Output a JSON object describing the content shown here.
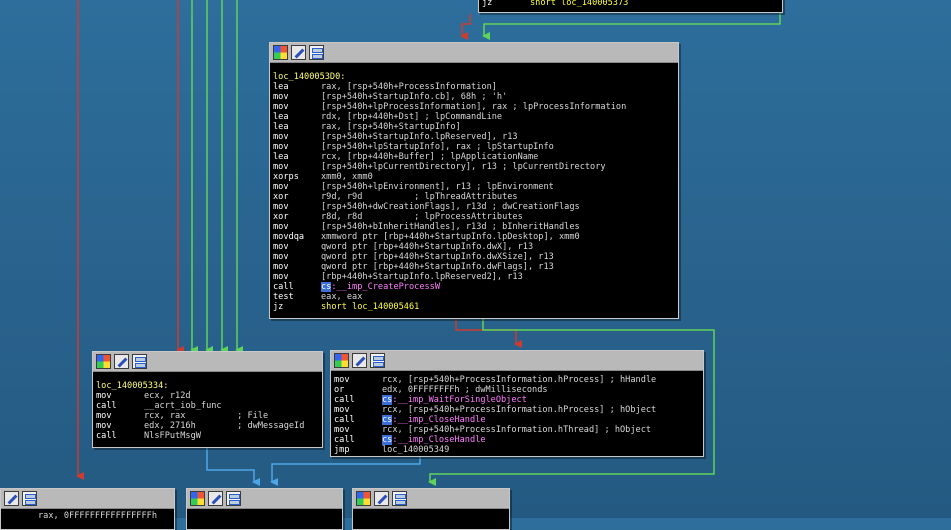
{
  "colors": {
    "background": "#2a6590",
    "edge_red": "#cf3b2f",
    "edge_green": "#5fd35a",
    "edge_blue": "#4ea6e6",
    "node_bg": "#000000",
    "titlebar": "#b9b9b9",
    "highlight": "#3b6fd8",
    "annotation_arrow": "#e3342a"
  },
  "icons": [
    "color-icon",
    "edit-icon",
    "graph-icon"
  ],
  "top_fragment": {
    "mnemonic": "jz",
    "operand": "short loc_140005373"
  },
  "main_block": {
    "label": "loc_1400053D0:",
    "lines": [
      {
        "mn": "lea",
        "op": "rax, [rsp+540h+ProcessInformation]"
      },
      {
        "mn": "mov",
        "op": "[rsp+540h+StartupInfo.cb], 68h ; 'h'"
      },
      {
        "mn": "mov",
        "op": "[rsp+540h+lpProcessInformation], rax ; lpProcessInformation"
      },
      {
        "mn": "lea",
        "op": "rdx, [rbp+440h+Dst] ; lpCommandLine"
      },
      {
        "mn": "lea",
        "op": "rax, [rsp+540h+StartupInfo]"
      },
      {
        "mn": "mov",
        "op": "[rsp+540h+StartupInfo.lpReserved], r13"
      },
      {
        "mn": "mov",
        "op": "[rsp+540h+lpStartupInfo], rax ; lpStartupInfo"
      },
      {
        "mn": "lea",
        "op": "rcx, [rbp+440h+Buffer] ; lpApplicationName"
      },
      {
        "mn": "mov",
        "op": "[rsp+540h+lpCurrentDirectory], r13 ; lpCurrentDirectory"
      },
      {
        "mn": "xorps",
        "op": "xmm0, xmm0"
      },
      {
        "mn": "mov",
        "op": "[rsp+540h+lpEnvironment], r13 ; lpEnvironment"
      },
      {
        "mn": "xor",
        "op": "r9d, r9d          ; lpThreadAttributes"
      },
      {
        "mn": "mov",
        "op": "[rsp+540h+dwCreationFlags], r13d ; dwCreationFlags"
      },
      {
        "mn": "xor",
        "op": "r8d, r8d          ; lpProcessAttributes"
      },
      {
        "mn": "mov",
        "op": "[rsp+540h+bInheritHandles], r13d ; bInheritHandles"
      },
      {
        "mn": "movdqa",
        "op": "xmmword ptr [rbp+440h+StartupInfo.lpDesktop], xmm0"
      },
      {
        "mn": "mov",
        "op": "qword ptr [rbp+440h+StartupInfo.dwX], r13"
      },
      {
        "mn": "mov",
        "op": "qword ptr [rbp+440h+StartupInfo.dwXSize], r13"
      },
      {
        "mn": "mov",
        "op": "qword ptr [rbp+440h+StartupInfo.dwFlags], r13"
      },
      {
        "mn": "mov",
        "op": "[rbp+440h+StartupInfo.lpReserved2], r13"
      }
    ],
    "call": {
      "mn": "call",
      "prefix": "cs",
      "rest": ":__imp_CreateProcessW"
    },
    "test": {
      "mn": "test",
      "op": "eax, eax"
    },
    "jz": {
      "mn": "jz",
      "op": "short loc_140005461"
    }
  },
  "left_block": {
    "label": "loc_140005334:",
    "lines": [
      {
        "mn": "mov",
        "op": "ecx, r12d"
      },
      {
        "mn": "call",
        "op": "__acrt_iob_func"
      },
      {
        "mn": "mov",
        "op": "rcx, rax          ; File"
      },
      {
        "mn": "mov",
        "op": "edx, 2716h        ; dwMessageId"
      },
      {
        "mn": "call",
        "op": "NlsFPutMsgW"
      }
    ]
  },
  "right_block": {
    "lines": [
      {
        "mn": "mov",
        "op": "rcx, [rsp+540h+ProcessInformation.hProcess] ; hHandle"
      },
      {
        "mn": "or",
        "op": "edx, 0FFFFFFFFh ; dwMilliseconds"
      },
      {
        "mn": "call",
        "prefix": "cs",
        "op": ":__imp_WaitForSingleObject"
      },
      {
        "mn": "mov",
        "op": "rcx, [rsp+540h+ProcessInformation.hProcess] ; hObject"
      },
      {
        "mn": "call",
        "prefix": "cs",
        "op": ":__imp_CloseHandle"
      },
      {
        "mn": "mov",
        "op": "rcx, [rsp+540h+ProcessInformation.hThread] ; hObject"
      },
      {
        "mn": "call",
        "prefix": "cs",
        "op": ":__imp_CloseHandle"
      },
      {
        "mn": "jmp",
        "op": "loc_140005349"
      }
    ]
  },
  "bottom_left_block": {
    "first_line": "rax, 0FFFFFFFFFFFFFFFFh"
  }
}
